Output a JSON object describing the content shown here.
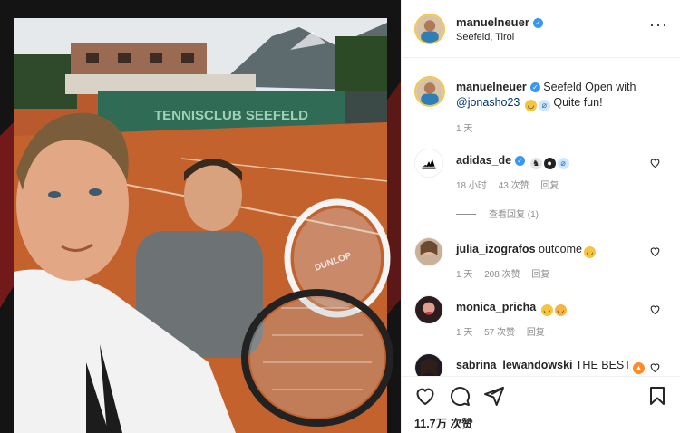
{
  "post": {
    "username": "manuelneuer",
    "location": "Seefeld, Tirol",
    "more_icon": "more-horizontal-icon",
    "caption_prefix": "Seefeld Open with",
    "caption_mention": "@jonasho23",
    "caption_suffix": "Quite fun!",
    "time": "1 天",
    "likes": "11.7万 次赞"
  },
  "media": {
    "banner_text": "TENNISCLUB SEEFELD",
    "racket_brand": "DUNLOP"
  },
  "comments": [
    {
      "username": "adidas_de",
      "text": "",
      "time": "18 小时",
      "likes": "43 次赞",
      "reply": "回复"
    },
    {
      "username": "julia_izografos",
      "text": "outcome",
      "time": "1 天",
      "likes": "208 次赞",
      "reply": "回复"
    },
    {
      "username": "monica_pricha",
      "text": "",
      "time": "1 天",
      "likes": "57 次赞",
      "reply": "回复"
    },
    {
      "username": "sabrina_lewandowski",
      "text": "THE BEST"
    }
  ],
  "view_replies": "查看回复 (1)",
  "colors": {
    "verified": "#3897f0",
    "mention": "#00376b",
    "meta": "#8e8e8e"
  }
}
